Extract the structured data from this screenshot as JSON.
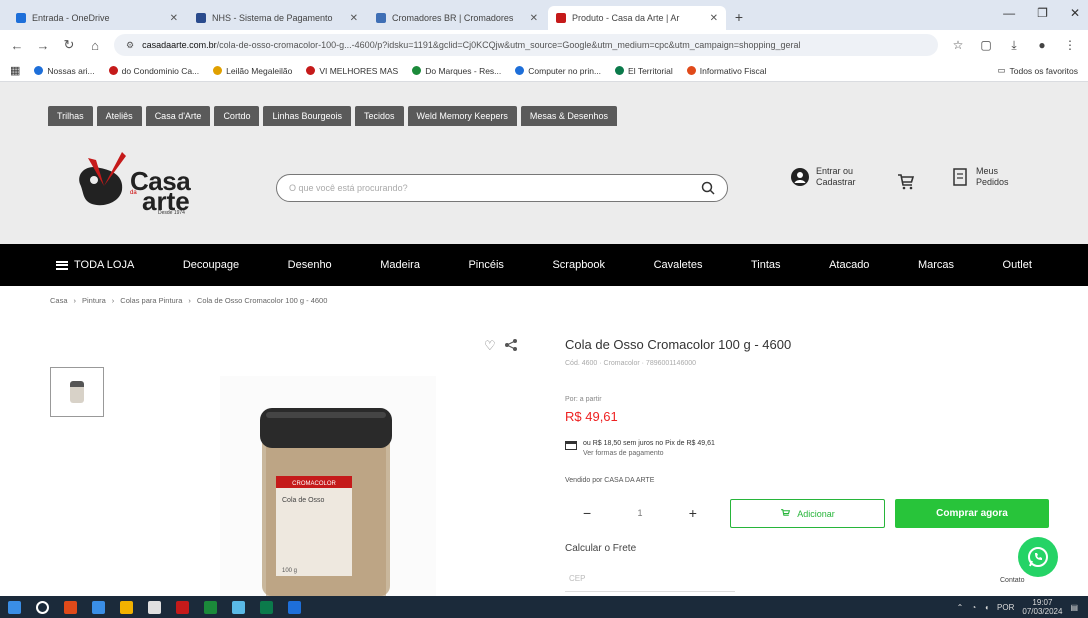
{
  "browser": {
    "tabs": [
      {
        "title": "Entrada - OneDrive",
        "color": "#1e6fd9",
        "active": false
      },
      {
        "title": "NHS - Sistema de Pagamento",
        "color": "#2a4b8d",
        "active": false
      },
      {
        "title": "Cromadores BR | Cromadores",
        "color": "#3f6fb5",
        "active": false
      },
      {
        "title": "Produto - Casa da Arte | Ar",
        "color": "#c51a1a",
        "active": true
      }
    ],
    "new_tab_glyph": "+",
    "url_host": "casadaarte.com.br",
    "url_rest": "/cola-de-osso-cromacolor-100-g...-4600/p?idsku=1191&gclid=Cj0KCQjw&utm_source=Google&utm_medium=cpc&utm_campaign=shopping_geral",
    "bookmarks": [
      {
        "label": "Nossas ari...",
        "color": "#1e6fd9"
      },
      {
        "label": "do Condominio Ca...",
        "color": "#c51a1a"
      },
      {
        "label": "Leilão Megaleilão",
        "color": "#e0a000"
      },
      {
        "label": "VI MELHORES MAS",
        "color": "#c51a1a"
      },
      {
        "label": "Do Marques - Res...",
        "color": "#1b8a3a"
      },
      {
        "label": "Computer no prin...",
        "color": "#1e6fd9"
      },
      {
        "label": "El Territorial",
        "color": "#0b7a4b"
      },
      {
        "label": "Informativo Fiscal",
        "color": "#e04a1a"
      }
    ],
    "bookmarks_right": "Todos os favoritos"
  },
  "site": {
    "store_tabs": [
      "Trilhas",
      "Ateliês",
      "Casa d'Arte",
      "Cortdo",
      "Linhas Bourgeois",
      "Tecidos",
      "Weld Memory Keepers",
      "Mesas & Desenhos"
    ],
    "logo": {
      "word1": "Casa",
      "word2": "arte",
      "mini": "da",
      "since": "Desde 1974"
    },
    "search_placeholder": "O que você está procurando?",
    "account_label": "Entrar ou Cadastrar",
    "orders_label": "Meus Pedidos",
    "categories": [
      "TODA LOJA",
      "Decoupage",
      "Desenho",
      "Madeira",
      "Pincéis",
      "Scrapbook",
      "Cavaletes",
      "Tintas",
      "Atacado",
      "Marcas",
      "Outlet"
    ],
    "breadcrumbs": [
      "Casa",
      "Pintura",
      "Colas para Pintura",
      "Cola de Osso Cromacolor 100 g - 4600"
    ]
  },
  "product": {
    "name": "Cola de Osso Cromacolor 100 g - 4600",
    "sku": "Cód. 4600 · Cromacolor · 7896001146000",
    "old_price_label": "Por: a partir",
    "price": "R$ 49,61",
    "installments": "ou R$ 18,50 sem juros no Pix de R$ 49,61",
    "installments_link": "Ver formas de pagamento",
    "seller": "Vendido por CASA DA ARTE",
    "qty_minus": "−",
    "qty_value": "1",
    "qty_plus": "+",
    "add_label": "Adicionar",
    "buy_label": "Comprar agora",
    "freight_label": "Calcular o Frete",
    "cep_placeholder": "CEP",
    "jar_label_top": "CROMACOLOR",
    "jar_label_mid": "Cola de Osso",
    "jar_weight": "100 g"
  },
  "whatsapp_label": "Contato",
  "taskbar": {
    "apps": [
      "#3a8ee6",
      "#ffffff",
      "#e04a1a",
      "#3a8ee6",
      "#f2b200",
      "#e0e0e0",
      "#c51a1a",
      "#1b8a3a",
      "#5ab9e6",
      "#0b7a4b",
      "#1e6fd9"
    ],
    "time": "19:07",
    "date": "07/03/2024",
    "lang": "POR"
  }
}
